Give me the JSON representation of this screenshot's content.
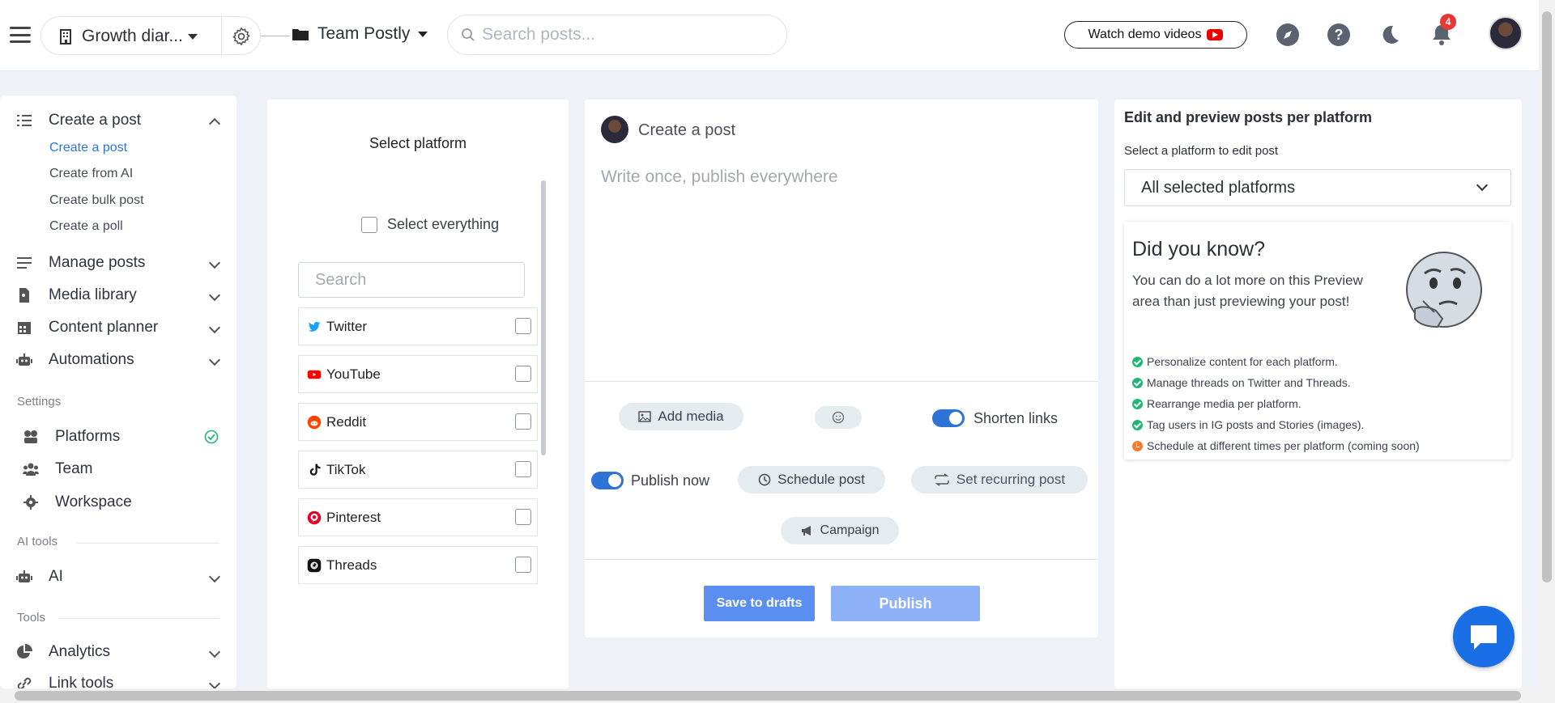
{
  "topbar": {
    "workspace_name": "Growth diar...",
    "team_name": "Team Postly",
    "search_placeholder": "Search posts...",
    "demo_button": "Watch demo videos",
    "notification_count": "4"
  },
  "sidebar": {
    "create_post": "Create a post",
    "sub_items": [
      "Create a post",
      "Create from AI",
      "Create bulk post",
      "Create a poll"
    ],
    "manage_posts": "Manage posts",
    "media_library": "Media library",
    "content_planner": "Content planner",
    "automations": "Automations",
    "settings_section": "Settings",
    "platforms": "Platforms",
    "team": "Team",
    "workspace": "Workspace",
    "ai_section": "AI tools",
    "ai": "AI",
    "tools_section": "Tools",
    "analytics": "Analytics",
    "link_tools": "Link tools"
  },
  "platform_panel": {
    "title": "Select platform",
    "select_all": "Select everything",
    "search_placeholder": "Search",
    "platforms": [
      "Twitter",
      "YouTube",
      "Reddit",
      "TikTok",
      "Pinterest",
      "Threads"
    ]
  },
  "composer": {
    "title": "Create a post",
    "placeholder": "Write once, publish everywhere",
    "add_media": "Add media",
    "shorten_links": "Shorten links",
    "publish_now": "Publish now",
    "schedule_post": "Schedule post",
    "recurring_post": "Set recurring post",
    "campaign": "Campaign",
    "save_drafts": "Save to drafts",
    "publish": "Publish"
  },
  "preview": {
    "title": "Edit and preview posts per platform",
    "subtitle": "Select a platform to edit post",
    "selected": "All selected platforms",
    "did_you_know": "Did you know?",
    "did_you_know_text": "You can do a lot more on this Preview area than just previewing your post!",
    "tips": [
      "Personalize content for each platform.",
      "Manage threads on Twitter and Threads.",
      "Rearrange media per platform.",
      "Tag users in IG posts and Stories (images).",
      "Schedule at different times per platform (coming soon)"
    ]
  },
  "colors": {
    "accent": "#2d74d6",
    "background": "#eef1f7",
    "success": "#22b573",
    "coming_soon": "#f07c2f"
  }
}
